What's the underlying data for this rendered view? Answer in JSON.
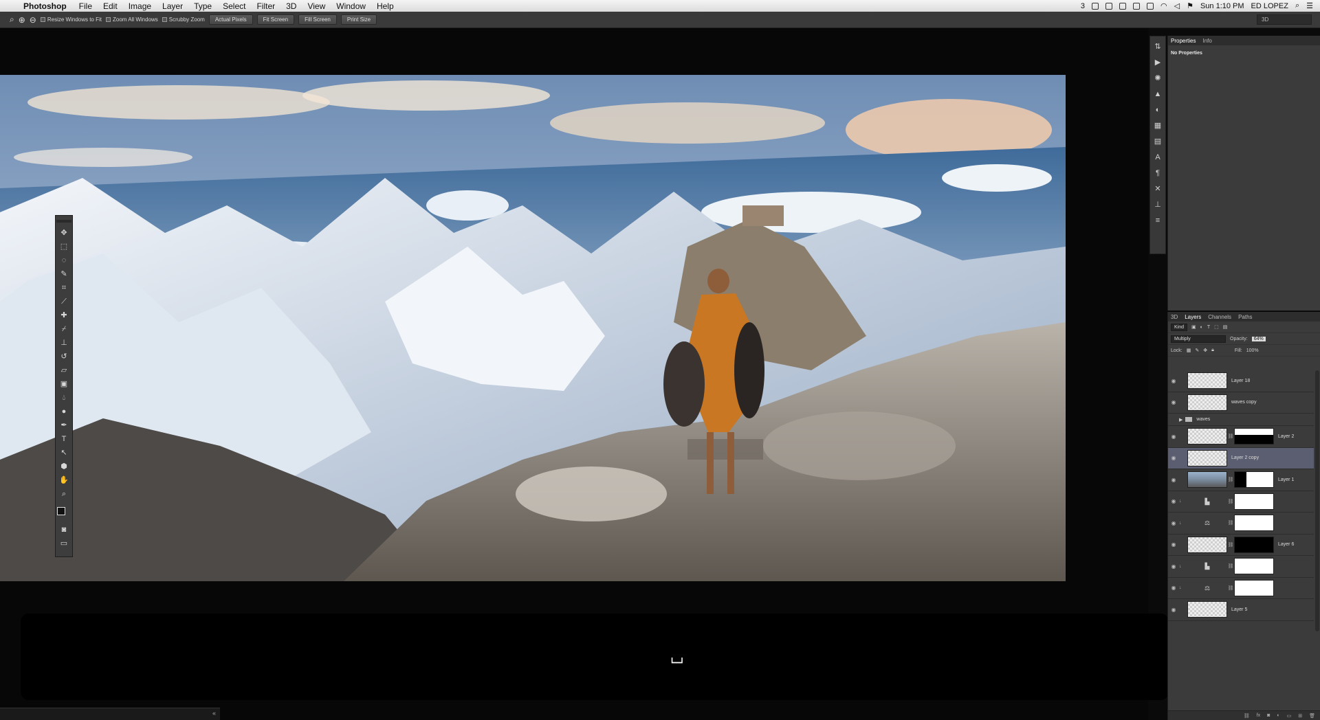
{
  "menubar": {
    "app_name": "Photoshop",
    "items": [
      "File",
      "Edit",
      "Image",
      "Layer",
      "Type",
      "Select",
      "Filter",
      "3D",
      "View",
      "Window",
      "Help"
    ],
    "status_badge": "3",
    "clock": "Sun 1:10 PM",
    "user": "ED LOPEZ"
  },
  "options_bar": {
    "resize_windows": "Resize Windows to Fit",
    "zoom_all": "Zoom All Windows",
    "scrubby_zoom": "Scrubby Zoom",
    "actual_pixels": "Actual Pixels",
    "fit_screen": "Fit Screen",
    "fill_screen": "Fill Screen",
    "print_size": "Print Size",
    "workspace": "3D"
  },
  "properties_panel": {
    "tabs": [
      "Properties",
      "Info"
    ],
    "message": "No Properties"
  },
  "layers_panel": {
    "tabs": [
      "3D",
      "Layers",
      "Channels",
      "Paths"
    ],
    "filter_kind": "Kind",
    "blend_mode": "Multiply",
    "opacity_label": "Opacity:",
    "opacity_value": "64%",
    "lock_label": "Lock:",
    "fill_label": "Fill:",
    "fill_value": "100%",
    "layers": [
      {
        "name": "Layer 18",
        "kind": "pixel"
      },
      {
        "name": "waves copy",
        "kind": "pixel"
      },
      {
        "name": "waves",
        "kind": "group"
      },
      {
        "name": "Layer 2",
        "kind": "pixel-mask"
      },
      {
        "name": "Layer 2 copy",
        "kind": "pixel",
        "selected": true
      },
      {
        "name": "Layer 1",
        "kind": "pixel-mask"
      },
      {
        "name": "",
        "kind": "adjustment"
      },
      {
        "name": "",
        "kind": "adjustment"
      },
      {
        "name": "Layer 6",
        "kind": "pixel-mask"
      },
      {
        "name": "",
        "kind": "adjustment"
      },
      {
        "name": "",
        "kind": "adjustment"
      },
      {
        "name": "Layer 5",
        "kind": "pixel"
      }
    ]
  },
  "hud": {
    "glyph": "⌴"
  },
  "colors": {
    "panel": "#3b3b3b",
    "menubar": "#e6e6e6",
    "selection": "#5a5e70"
  }
}
